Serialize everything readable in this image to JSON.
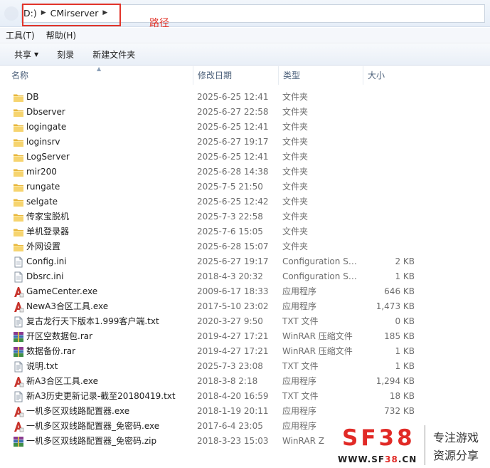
{
  "address": {
    "crumbs": [
      "D:)",
      "CMirserver"
    ],
    "annotation": "路径",
    "highlight_color": "#e2342a"
  },
  "menu": [
    "工具(T)",
    "帮助(H)"
  ],
  "toolbar": {
    "share": "共享",
    "burn": "刻录",
    "new_folder": "新建文件夹"
  },
  "columns": {
    "name": "名称",
    "date": "修改日期",
    "type": "类型",
    "size": "大小"
  },
  "files": [
    {
      "name": "DB",
      "date": "2025-6-25 12:41",
      "type": "文件夹",
      "size": "",
      "icon": "folder-icon"
    },
    {
      "name": "Dbserver",
      "date": "2025-6-27 22:58",
      "type": "文件夹",
      "size": "",
      "icon": "folder-icon"
    },
    {
      "name": "logingate",
      "date": "2025-6-25 12:41",
      "type": "文件夹",
      "size": "",
      "icon": "folder-icon"
    },
    {
      "name": "loginsrv",
      "date": "2025-6-27 19:17",
      "type": "文件夹",
      "size": "",
      "icon": "folder-icon"
    },
    {
      "name": "LogServer",
      "date": "2025-6-25 12:41",
      "type": "文件夹",
      "size": "",
      "icon": "folder-icon"
    },
    {
      "name": "mir200",
      "date": "2025-6-28 14:38",
      "type": "文件夹",
      "size": "",
      "icon": "folder-icon"
    },
    {
      "name": "rungate",
      "date": "2025-7-5 21:50",
      "type": "文件夹",
      "size": "",
      "icon": "folder-icon"
    },
    {
      "name": "selgate",
      "date": "2025-6-25 12:42",
      "type": "文件夹",
      "size": "",
      "icon": "folder-icon"
    },
    {
      "name": "传家宝脱机",
      "date": "2025-7-3 22:58",
      "type": "文件夹",
      "size": "",
      "icon": "folder-icon"
    },
    {
      "name": "单机登录器",
      "date": "2025-7-6 15:05",
      "type": "文件夹",
      "size": "",
      "icon": "folder-icon"
    },
    {
      "name": "外网设置",
      "date": "2025-6-28 15:07",
      "type": "文件夹",
      "size": "",
      "icon": "folder-icon"
    },
    {
      "name": "Config.ini",
      "date": "2025-6-27 19:17",
      "type": "Configuration Se...",
      "size": "2 KB",
      "icon": "settings-file-icon"
    },
    {
      "name": "Dbsrc.ini",
      "date": "2018-4-3 20:32",
      "type": "Configuration Se...",
      "size": "1 KB",
      "icon": "settings-file-icon"
    },
    {
      "name": "GameCenter.exe",
      "date": "2009-6-17 18:33",
      "type": "应用程序",
      "size": "646 KB",
      "icon": "app-icon"
    },
    {
      "name": "NewA3合区工具.exe",
      "date": "2017-5-10 23:02",
      "type": "应用程序",
      "size": "1,473 KB",
      "icon": "app-icon"
    },
    {
      "name": "复古龙行天下版本1.999客户端.txt",
      "date": "2020-3-27 9:50",
      "type": "TXT 文件",
      "size": "0 KB",
      "icon": "text-file-icon"
    },
    {
      "name": "开区空数据包.rar",
      "date": "2019-4-27 17:21",
      "type": "WinRAR 压缩文件",
      "size": "185 KB",
      "icon": "archive-icon"
    },
    {
      "name": "数据备份.rar",
      "date": "2019-4-27 17:21",
      "type": "WinRAR 压缩文件",
      "size": "1 KB",
      "icon": "archive-icon"
    },
    {
      "name": "说明.txt",
      "date": "2025-7-3 23:08",
      "type": "TXT 文件",
      "size": "1 KB",
      "icon": "text-file-icon"
    },
    {
      "name": "新A3合区工具.exe",
      "date": "2018-3-8 2:18",
      "type": "应用程序",
      "size": "1,294 KB",
      "icon": "app-icon"
    },
    {
      "name": "新A3历史更新记录-截至20180419.txt",
      "date": "2018-4-20 16:59",
      "type": "TXT 文件",
      "size": "18 KB",
      "icon": "text-file-icon"
    },
    {
      "name": "一机多区双线路配置器.exe",
      "date": "2018-1-19 20:11",
      "type": "应用程序",
      "size": "732 KB",
      "icon": "app-icon"
    },
    {
      "name": "一机多区双线路配置器_免密码.exe",
      "date": "2017-6-4 23:05",
      "type": "应用程序",
      "size": "",
      "icon": "app-icon"
    },
    {
      "name": "一机多区双线路配置器_免密码.zip",
      "date": "2018-3-23 15:03",
      "type": "WinRAR Z",
      "size": "",
      "icon": "archive-icon"
    }
  ],
  "watermark": {
    "logo": "SF38",
    "url_prefix": "WWW.SF",
    "url_mid": "38",
    "url_suffix": ".CN",
    "tagline1": "专注游戏",
    "tagline2": "资源分享"
  }
}
